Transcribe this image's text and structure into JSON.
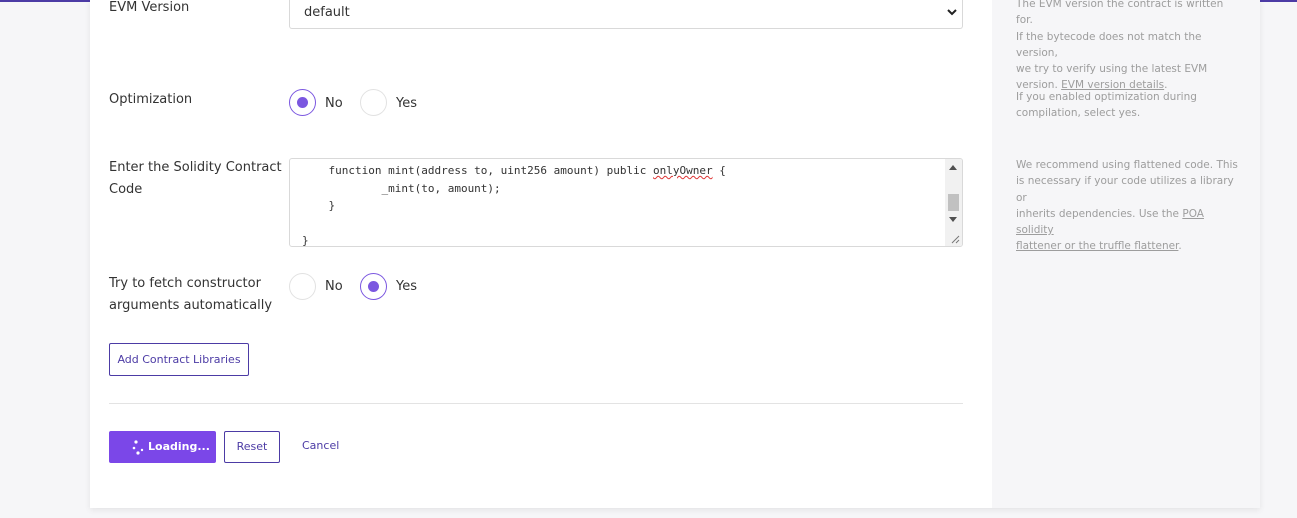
{
  "form": {
    "evm_version": {
      "label": "EVM Version",
      "value": "default"
    },
    "optimization": {
      "label": "Optimization",
      "no_label": "No",
      "yes_label": "Yes",
      "selected": "No"
    },
    "contract_code": {
      "label_line1": "Enter the Solidity Contract",
      "label_line2": "Code",
      "line1_prefix": "    function mint(address to, uint256 amount) public ",
      "line1_underlined": "onlyOwner",
      "line1_suffix": " {",
      "line2": "            _mint(to, amount);",
      "line3": "    }",
      "line4": "",
      "line5": "}"
    },
    "constructor_args": {
      "label_line1": "Try to fetch constructor",
      "label_line2": "arguments automatically",
      "no_label": "No",
      "yes_label": "Yes",
      "selected": "Yes"
    },
    "add_libraries_label": "Add Contract Libraries",
    "actions": {
      "loading_label": "Loading...",
      "reset_label": "Reset",
      "cancel_label": "Cancel"
    }
  },
  "help": {
    "evm": {
      "line1": "The EVM version the contract is written for.",
      "line2": "If the bytecode does not match the version,",
      "line3": "we try to verify using the latest EVM",
      "line4_prefix": "version. ",
      "line4_link": "EVM version details",
      "line4_suffix": "."
    },
    "optimization": {
      "line1": "If you enabled optimization during",
      "line2": "compilation, select yes."
    },
    "code": {
      "line1": "We recommend using flattened code. This",
      "line2": "is necessary if your code utilizes a library or",
      "line3_prefix": "inherits dependencies. Use the ",
      "line3_link": "POA solidity",
      "line4_link": "flattener or the truffle flattener",
      "line4_suffix": "."
    }
  },
  "colors": {
    "accent": "#7b47e8",
    "brand": "#4c3ba5",
    "top_bar": "#4c3ba5"
  },
  "icons": {
    "select_arrow": "chevron-down-icon",
    "loading": "spinner-icon",
    "resize": "resize-grip-icon"
  }
}
